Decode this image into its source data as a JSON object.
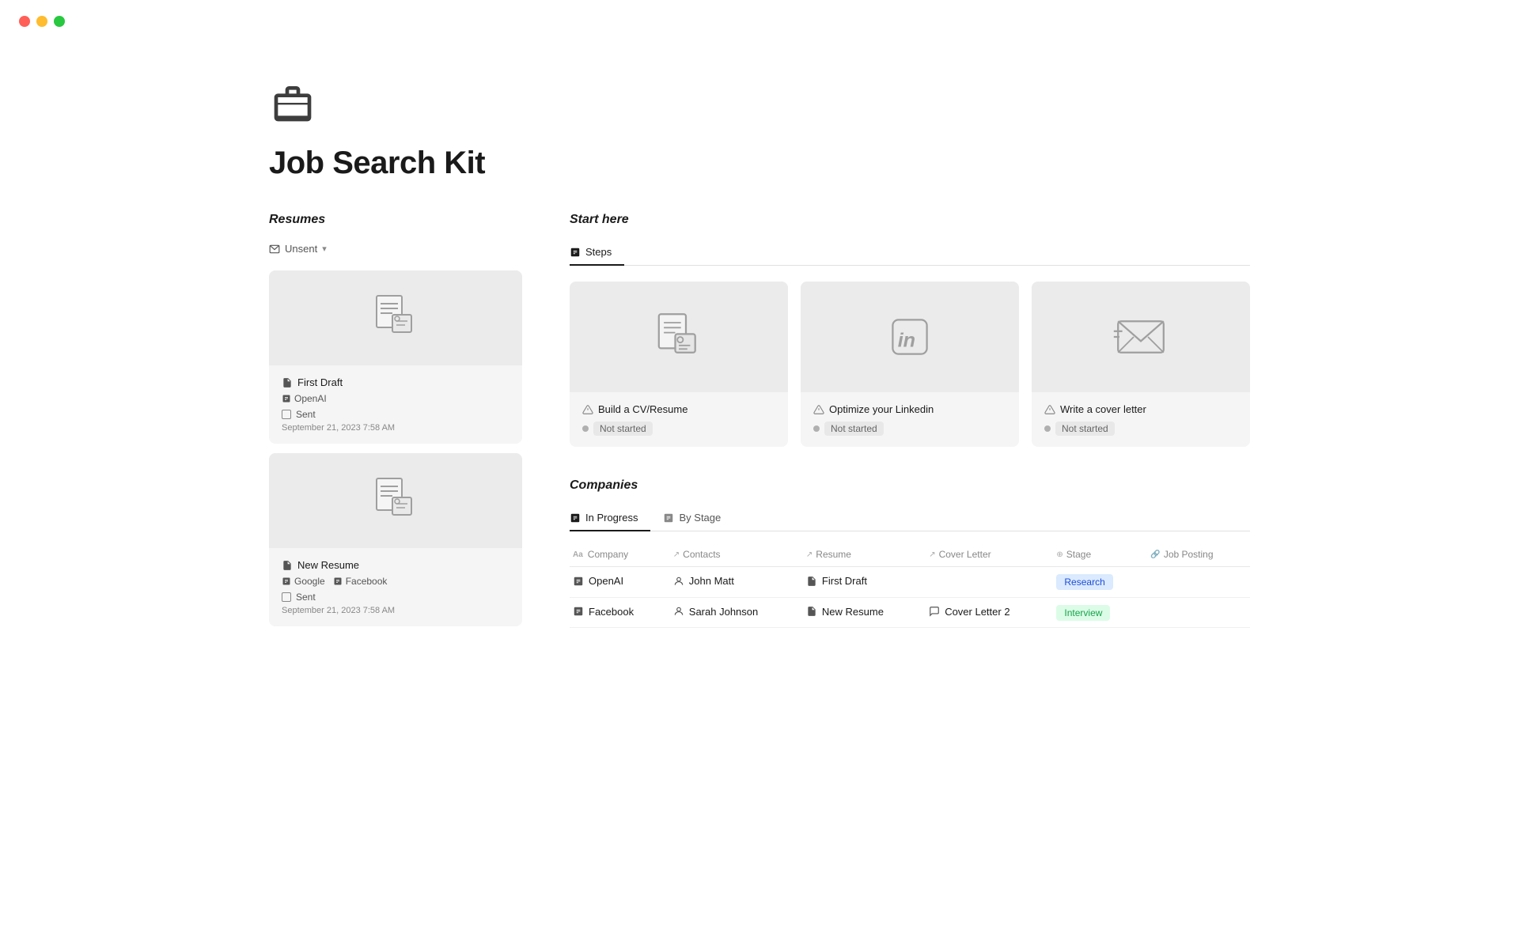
{
  "traffic_lights": {
    "red": "red",
    "yellow": "yellow",
    "green": "green"
  },
  "page": {
    "icon_label": "briefcase-icon",
    "title": "Job Search Kit"
  },
  "resumes": {
    "section_heading": "Resumes",
    "filter_label": "Unsent",
    "cards": [
      {
        "title": "First Draft",
        "meta": [
          {
            "label": "OpenAI",
            "icon": "company-icon"
          }
        ],
        "sent": "Sent",
        "date": "September 21, 2023 7:58 AM"
      },
      {
        "title": "New Resume",
        "meta": [
          {
            "label": "Google",
            "icon": "company-icon"
          },
          {
            "label": "Facebook",
            "icon": "company-icon"
          }
        ],
        "sent": "Sent",
        "date": "September 21, 2023 7:58 AM"
      }
    ]
  },
  "start_here": {
    "section_heading": "Start here",
    "tabs": [
      {
        "label": "Steps",
        "icon": "steps-icon",
        "active": true
      }
    ],
    "steps": [
      {
        "title": "Build a CV/Resume",
        "status": "Not started",
        "icon": "cv-icon"
      },
      {
        "title": "Optimize your Linkedin",
        "status": "Not started",
        "icon": "linkedin-icon"
      },
      {
        "title": "Write a cover letter",
        "status": "Not started",
        "icon": "email-icon"
      }
    ]
  },
  "companies": {
    "section_heading": "Companies",
    "tabs": [
      {
        "label": "In Progress",
        "icon": "progress-icon",
        "active": true
      },
      {
        "label": "By Stage",
        "icon": "stage-icon",
        "active": false
      }
    ],
    "columns": [
      {
        "label": "Company",
        "icon": "aa-icon"
      },
      {
        "label": "Contacts",
        "icon": "arrow-icon"
      },
      {
        "label": "Resume",
        "icon": "arrow-icon"
      },
      {
        "label": "Cover Letter",
        "icon": "arrow-icon"
      },
      {
        "label": "Stage",
        "icon": "stage-col-icon"
      },
      {
        "label": "Job Posting",
        "icon": "link-icon"
      }
    ],
    "rows": [
      {
        "company": "OpenAI",
        "contacts": "John Matt",
        "resume": "First Draft",
        "cover_letter": "",
        "stage": "Research",
        "stage_type": "research",
        "job_posting": ""
      },
      {
        "company": "Facebook",
        "contacts": "Sarah Johnson",
        "resume": "New Resume",
        "cover_letter": "Cover Letter 2",
        "stage": "Interview",
        "stage_type": "interview",
        "job_posting": ""
      }
    ]
  }
}
